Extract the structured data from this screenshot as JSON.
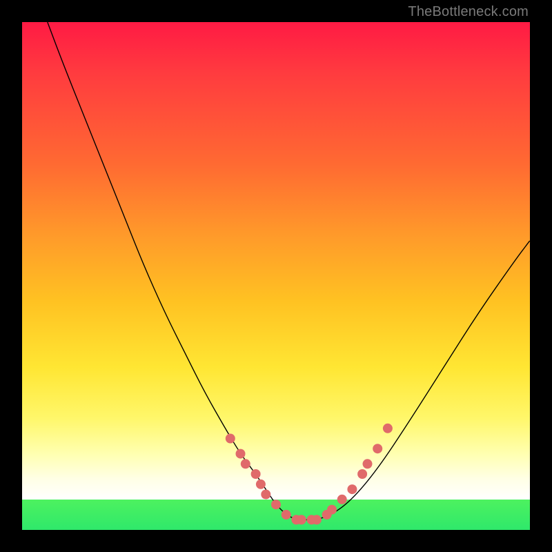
{
  "watermark": "TheBottleneck.com",
  "colors": {
    "dot": "#e06a6a",
    "curve": "#000000"
  },
  "chart_data": {
    "type": "line",
    "title": "",
    "xlabel": "",
    "ylabel": "",
    "xlim": [
      0,
      100
    ],
    "ylim": [
      0,
      100
    ],
    "grid": false,
    "legend": false,
    "series": [
      {
        "name": "bottleneck-curve",
        "x": [
          5,
          8,
          12,
          16,
          20,
          24,
          28,
          32,
          36,
          40,
          43,
          46,
          48,
          50,
          52,
          54,
          56,
          58,
          61,
          65,
          70,
          76,
          83,
          90,
          97,
          100
        ],
        "y": [
          100,
          92,
          82,
          72,
          62,
          52,
          43,
          35,
          27,
          20,
          15,
          11,
          8,
          5,
          3,
          2,
          2,
          2,
          3,
          6,
          12,
          21,
          32,
          43,
          53,
          57
        ]
      }
    ],
    "highlight_points": {
      "name": "salmon-dots",
      "x": [
        41,
        43,
        44,
        46,
        47,
        48,
        50,
        52,
        54,
        55,
        57,
        58,
        60,
        61,
        63,
        65,
        67,
        68,
        70,
        72
      ],
      "y": [
        18,
        15,
        13,
        11,
        9,
        7,
        5,
        3,
        2,
        2,
        2,
        2,
        3,
        4,
        6,
        8,
        11,
        13,
        16,
        20
      ]
    }
  }
}
